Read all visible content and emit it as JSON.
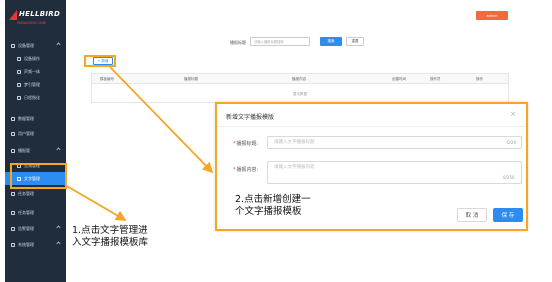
{
  "logo": {
    "main": "HELLBIRD",
    "sub": "PANASONIC LINE"
  },
  "sidebar": {
    "items": [
      {
        "label": "设备管理",
        "type": "group"
      },
      {
        "label": "设备操作",
        "type": "sub"
      },
      {
        "label": "声频一体",
        "type": "sub"
      },
      {
        "label": "梦引管理",
        "type": "sub"
      },
      {
        "label": "日程指化",
        "type": "sub"
      },
      {
        "label": "数据管理",
        "type": "group"
      },
      {
        "label": "用户管理",
        "type": "group"
      },
      {
        "label": "播报管",
        "type": "group"
      },
      {
        "label": "音频管理",
        "type": "sub"
      },
      {
        "label": "文字管理",
        "type": "sub-active"
      },
      {
        "label": "任务管理",
        "type": "group"
      },
      {
        "label": "任务管理",
        "type": "group"
      },
      {
        "label": "告警管理",
        "type": "group"
      },
      {
        "label": "系统管理",
        "type": "group"
      }
    ]
  },
  "header": {
    "action_label": "admin"
  },
  "filter": {
    "label": "播报标题",
    "placeholder": "请输入播报标题搜索",
    "search_label": "搜索",
    "reset_label": "重置"
  },
  "toolbar": {
    "add_label": "+ 新增"
  },
  "table": {
    "headers": [
      "模板编号",
      "播报标题",
      "播报内容",
      "创建时间",
      "操作员",
      "操作"
    ],
    "empty_text": "暂无数据"
  },
  "dialog": {
    "title": "新增文字播报模版",
    "close_label": "×",
    "title_field": {
      "label": "播报标题:",
      "placeholder": "请输入文字播报标题",
      "count": "0/20"
    },
    "content_field": {
      "label": "播报内容:",
      "placeholder": "请输入文字播报内容",
      "count": "0/250"
    },
    "cancel_label": "取 消",
    "save_label": "保 存"
  },
  "annotations": {
    "step1": [
      "1.点击文字管理进",
      "入文字播报模板库"
    ],
    "step2": [
      "2.点击新增创建一",
      "个文字播报模板"
    ]
  },
  "colors": {
    "sidebar_bg": "#1f2d3d",
    "accent": "#2d8cf0",
    "highlight": "#f5a623",
    "brand": "#f06a3a"
  }
}
